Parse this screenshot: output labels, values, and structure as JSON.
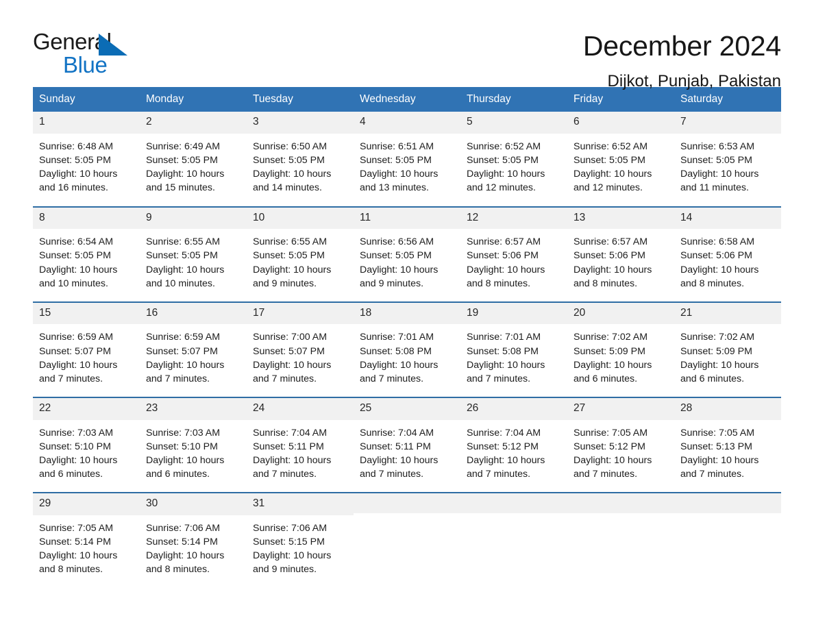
{
  "brand": {
    "name_top": "General",
    "name_bottom": "Blue",
    "color_blue": "#1273c4",
    "triangle_color": "#0b6cb5"
  },
  "header": {
    "title": "December 2024",
    "location": "Dijkot, Punjab, Pakistan"
  },
  "theme": {
    "header_bg": "#3073b4",
    "row_divider": "#2e6da4",
    "daynum_bg": "#f1f1f1",
    "text": "#1c1c1c"
  },
  "calendar": {
    "weekdays": [
      "Sunday",
      "Monday",
      "Tuesday",
      "Wednesday",
      "Thursday",
      "Friday",
      "Saturday"
    ],
    "weeks": [
      [
        {
          "day": "1",
          "sunrise": "Sunrise: 6:48 AM",
          "sunset": "Sunset: 5:05 PM",
          "daylight_1": "Daylight: 10 hours",
          "daylight_2": "and 16 minutes."
        },
        {
          "day": "2",
          "sunrise": "Sunrise: 6:49 AM",
          "sunset": "Sunset: 5:05 PM",
          "daylight_1": "Daylight: 10 hours",
          "daylight_2": "and 15 minutes."
        },
        {
          "day": "3",
          "sunrise": "Sunrise: 6:50 AM",
          "sunset": "Sunset: 5:05 PM",
          "daylight_1": "Daylight: 10 hours",
          "daylight_2": "and 14 minutes."
        },
        {
          "day": "4",
          "sunrise": "Sunrise: 6:51 AM",
          "sunset": "Sunset: 5:05 PM",
          "daylight_1": "Daylight: 10 hours",
          "daylight_2": "and 13 minutes."
        },
        {
          "day": "5",
          "sunrise": "Sunrise: 6:52 AM",
          "sunset": "Sunset: 5:05 PM",
          "daylight_1": "Daylight: 10 hours",
          "daylight_2": "and 12 minutes."
        },
        {
          "day": "6",
          "sunrise": "Sunrise: 6:52 AM",
          "sunset": "Sunset: 5:05 PM",
          "daylight_1": "Daylight: 10 hours",
          "daylight_2": "and 12 minutes."
        },
        {
          "day": "7",
          "sunrise": "Sunrise: 6:53 AM",
          "sunset": "Sunset: 5:05 PM",
          "daylight_1": "Daylight: 10 hours",
          "daylight_2": "and 11 minutes."
        }
      ],
      [
        {
          "day": "8",
          "sunrise": "Sunrise: 6:54 AM",
          "sunset": "Sunset: 5:05 PM",
          "daylight_1": "Daylight: 10 hours",
          "daylight_2": "and 10 minutes."
        },
        {
          "day": "9",
          "sunrise": "Sunrise: 6:55 AM",
          "sunset": "Sunset: 5:05 PM",
          "daylight_1": "Daylight: 10 hours",
          "daylight_2": "and 10 minutes."
        },
        {
          "day": "10",
          "sunrise": "Sunrise: 6:55 AM",
          "sunset": "Sunset: 5:05 PM",
          "daylight_1": "Daylight: 10 hours",
          "daylight_2": "and 9 minutes."
        },
        {
          "day": "11",
          "sunrise": "Sunrise: 6:56 AM",
          "sunset": "Sunset: 5:05 PM",
          "daylight_1": "Daylight: 10 hours",
          "daylight_2": "and 9 minutes."
        },
        {
          "day": "12",
          "sunrise": "Sunrise: 6:57 AM",
          "sunset": "Sunset: 5:06 PM",
          "daylight_1": "Daylight: 10 hours",
          "daylight_2": "and 8 minutes."
        },
        {
          "day": "13",
          "sunrise": "Sunrise: 6:57 AM",
          "sunset": "Sunset: 5:06 PM",
          "daylight_1": "Daylight: 10 hours",
          "daylight_2": "and 8 minutes."
        },
        {
          "day": "14",
          "sunrise": "Sunrise: 6:58 AM",
          "sunset": "Sunset: 5:06 PM",
          "daylight_1": "Daylight: 10 hours",
          "daylight_2": "and 8 minutes."
        }
      ],
      [
        {
          "day": "15",
          "sunrise": "Sunrise: 6:59 AM",
          "sunset": "Sunset: 5:07 PM",
          "daylight_1": "Daylight: 10 hours",
          "daylight_2": "and 7 minutes."
        },
        {
          "day": "16",
          "sunrise": "Sunrise: 6:59 AM",
          "sunset": "Sunset: 5:07 PM",
          "daylight_1": "Daylight: 10 hours",
          "daylight_2": "and 7 minutes."
        },
        {
          "day": "17",
          "sunrise": "Sunrise: 7:00 AM",
          "sunset": "Sunset: 5:07 PM",
          "daylight_1": "Daylight: 10 hours",
          "daylight_2": "and 7 minutes."
        },
        {
          "day": "18",
          "sunrise": "Sunrise: 7:01 AM",
          "sunset": "Sunset: 5:08 PM",
          "daylight_1": "Daylight: 10 hours",
          "daylight_2": "and 7 minutes."
        },
        {
          "day": "19",
          "sunrise": "Sunrise: 7:01 AM",
          "sunset": "Sunset: 5:08 PM",
          "daylight_1": "Daylight: 10 hours",
          "daylight_2": "and 7 minutes."
        },
        {
          "day": "20",
          "sunrise": "Sunrise: 7:02 AM",
          "sunset": "Sunset: 5:09 PM",
          "daylight_1": "Daylight: 10 hours",
          "daylight_2": "and 6 minutes."
        },
        {
          "day": "21",
          "sunrise": "Sunrise: 7:02 AM",
          "sunset": "Sunset: 5:09 PM",
          "daylight_1": "Daylight: 10 hours",
          "daylight_2": "and 6 minutes."
        }
      ],
      [
        {
          "day": "22",
          "sunrise": "Sunrise: 7:03 AM",
          "sunset": "Sunset: 5:10 PM",
          "daylight_1": "Daylight: 10 hours",
          "daylight_2": "and 6 minutes."
        },
        {
          "day": "23",
          "sunrise": "Sunrise: 7:03 AM",
          "sunset": "Sunset: 5:10 PM",
          "daylight_1": "Daylight: 10 hours",
          "daylight_2": "and 6 minutes."
        },
        {
          "day": "24",
          "sunrise": "Sunrise: 7:04 AM",
          "sunset": "Sunset: 5:11 PM",
          "daylight_1": "Daylight: 10 hours",
          "daylight_2": "and 7 minutes."
        },
        {
          "day": "25",
          "sunrise": "Sunrise: 7:04 AM",
          "sunset": "Sunset: 5:11 PM",
          "daylight_1": "Daylight: 10 hours",
          "daylight_2": "and 7 minutes."
        },
        {
          "day": "26",
          "sunrise": "Sunrise: 7:04 AM",
          "sunset": "Sunset: 5:12 PM",
          "daylight_1": "Daylight: 10 hours",
          "daylight_2": "and 7 minutes."
        },
        {
          "day": "27",
          "sunrise": "Sunrise: 7:05 AM",
          "sunset": "Sunset: 5:12 PM",
          "daylight_1": "Daylight: 10 hours",
          "daylight_2": "and 7 minutes."
        },
        {
          "day": "28",
          "sunrise": "Sunrise: 7:05 AM",
          "sunset": "Sunset: 5:13 PM",
          "daylight_1": "Daylight: 10 hours",
          "daylight_2": "and 7 minutes."
        }
      ],
      [
        {
          "day": "29",
          "sunrise": "Sunrise: 7:05 AM",
          "sunset": "Sunset: 5:14 PM",
          "daylight_1": "Daylight: 10 hours",
          "daylight_2": "and 8 minutes."
        },
        {
          "day": "30",
          "sunrise": "Sunrise: 7:06 AM",
          "sunset": "Sunset: 5:14 PM",
          "daylight_1": "Daylight: 10 hours",
          "daylight_2": "and 8 minutes."
        },
        {
          "day": "31",
          "sunrise": "Sunrise: 7:06 AM",
          "sunset": "Sunset: 5:15 PM",
          "daylight_1": "Daylight: 10 hours",
          "daylight_2": "and 9 minutes."
        },
        {
          "day": "",
          "sunrise": "",
          "sunset": "",
          "daylight_1": "",
          "daylight_2": ""
        },
        {
          "day": "",
          "sunrise": "",
          "sunset": "",
          "daylight_1": "",
          "daylight_2": ""
        },
        {
          "day": "",
          "sunrise": "",
          "sunset": "",
          "daylight_1": "",
          "daylight_2": ""
        },
        {
          "day": "",
          "sunrise": "",
          "sunset": "",
          "daylight_1": "",
          "daylight_2": ""
        }
      ]
    ]
  }
}
